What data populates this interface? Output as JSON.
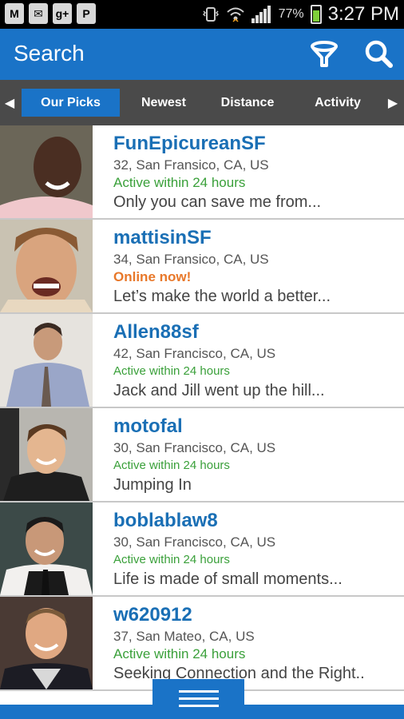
{
  "status_bar": {
    "icons": [
      "gmail-icon",
      "mail-icon",
      "google-plus-icon",
      "pinterest-icon"
    ],
    "icon_glyphs": [
      "M",
      "✉",
      "g+",
      "P"
    ],
    "battery_percent": "77%",
    "battery_level": 0.77,
    "time": "3:27 PM"
  },
  "action_bar": {
    "title": "Search",
    "color": "#1a73c7"
  },
  "tabs": {
    "items": [
      {
        "label": "Our Picks",
        "active": true
      },
      {
        "label": "Newest",
        "active": false
      },
      {
        "label": "Distance",
        "active": false
      },
      {
        "label": "Activity",
        "active": false
      }
    ],
    "left_arrow": "◀",
    "right_arrow": "▶"
  },
  "profiles": [
    {
      "username": "FunEpicureanSF",
      "location": "32, San Fransico, CA, US",
      "status": "Active within 24 hours",
      "status_type": "active",
      "blurb": "Only you can save me from...",
      "photo": "profile-photo"
    },
    {
      "username": "mattisinSF",
      "location": "34, San Fransico, CA, US",
      "status": "Online now!",
      "status_type": "online",
      "blurb": "Let’s make the world a better...",
      "photo": "profile-photo"
    },
    {
      "username": "Allen88sf",
      "location": "42, San Francisco, CA, US",
      "status": "Active within 24 hours",
      "status_type": "active-small",
      "blurb": "Jack and Jill went up the hill...",
      "photo": "profile-photo"
    },
    {
      "username": "motofal",
      "location": "30, San Francisco, CA, US",
      "status": "Active within 24 hours",
      "status_type": "active-small",
      "blurb": "Jumping In",
      "photo": "profile-photo"
    },
    {
      "username": "boblablaw8",
      "location": "30, San Francisco, CA, US",
      "status": "Active within 24 hours",
      "status_type": "active-small",
      "blurb": "Life is made of small moments...",
      "photo": "profile-photo"
    },
    {
      "username": "w620912",
      "location": "37, San Mateo, CA, US",
      "status": "Active within 24 hours",
      "status_type": "active",
      "blurb": "Seeking Connection and the Right..",
      "photo": "profile-photo"
    }
  ]
}
